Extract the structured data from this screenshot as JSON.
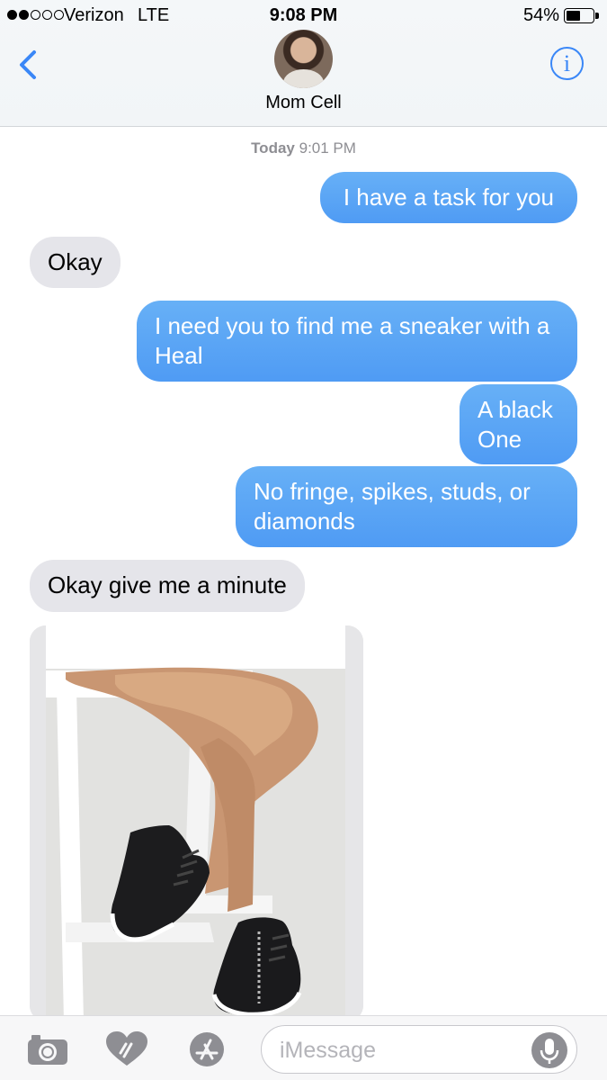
{
  "status_bar": {
    "carrier": "Verizon",
    "network": "LTE",
    "time": "9:08 PM",
    "battery_percent": "54%",
    "battery_level": 0.54,
    "signal_bars": 2,
    "signal_total": 5
  },
  "conversation": {
    "contact_name": "Mom Cell",
    "timestamp_day": "Today",
    "timestamp_time": "9:01 PM"
  },
  "messages": [
    {
      "direction": "outgoing",
      "text": "I have a task for you"
    },
    {
      "direction": "incoming",
      "text": "Okay"
    },
    {
      "direction": "outgoing",
      "text": "I need you to find me a sneaker with a Heal"
    },
    {
      "direction": "outgoing",
      "text": "A black One"
    },
    {
      "direction": "outgoing",
      "text": "No fringe, spikes, studs, or diamonds"
    },
    {
      "direction": "incoming",
      "text": "Okay give me a minute"
    },
    {
      "direction": "incoming",
      "type": "image",
      "content": "black-wedge-sneakers-photo"
    }
  ],
  "input_bar": {
    "placeholder": "iMessage",
    "icons": [
      "camera-icon",
      "digital-touch-icon",
      "app-store-icon",
      "microphone-icon"
    ]
  },
  "colors": {
    "outgoing_bubble": "#4f9bf4",
    "incoming_bubble": "#e5e5ea",
    "accent": "#3a87f7"
  }
}
